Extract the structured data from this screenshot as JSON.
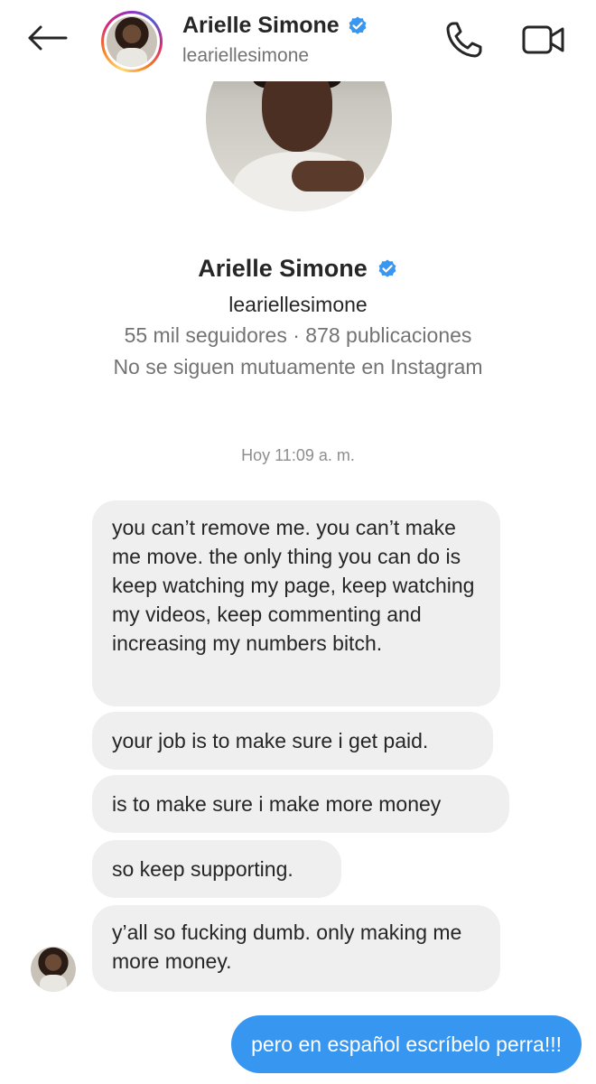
{
  "header": {
    "back_icon": "arrow-left-icon",
    "name": "Arielle Simone",
    "username": "leariellesimone",
    "verified_icon": "verified-badge-icon",
    "call_icon": "phone-icon",
    "video_icon": "video-camera-icon"
  },
  "profile": {
    "name": "Arielle Simone",
    "username": "leariellesimone",
    "stats": "55 mil seguidores · 878 publicaciones",
    "mutual": "No se siguen mutuamente en Instagram"
  },
  "thread": {
    "timestamp": "Hoy 11:09 a. m.",
    "incoming": [
      "you can’t remove me. you can’t make me move. the only thing you can do is keep watching my page, keep watching my videos, keep commenting and increasing my numbers bitch.",
      "your job is to make sure i get paid.",
      "is to make sure i make more money",
      "so keep supporting.",
      "y’all so fucking dumb. only making me more money."
    ],
    "outgoing": [
      "pero en español escríbelo perra!!!"
    ]
  },
  "colors": {
    "accent_blue": "#3797f0",
    "verified_blue": "#3897f0",
    "bubble_gray": "#efefef",
    "muted_text": "#737373"
  }
}
